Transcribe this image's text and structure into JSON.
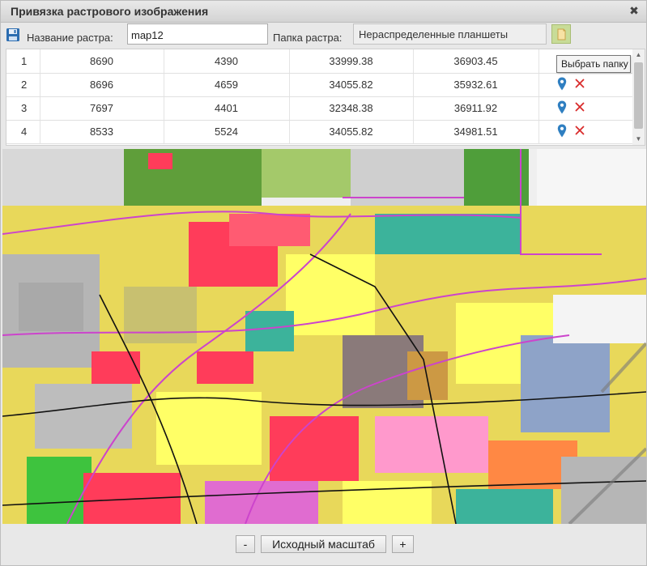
{
  "window": {
    "title": "Привязка растрового изображения",
    "close_glyph": "✖"
  },
  "toolbar": {
    "save_icon": "floppy-disk-icon",
    "raster_name_label": "Название растра:",
    "raster_name_value": "map12",
    "raster_folder_label": "Папка растра:",
    "raster_folder_value": "Нераспределенные планшеты",
    "select_folder_icon": "folder-icon",
    "select_folder_tooltip": "Выбрать папку"
  },
  "points": {
    "rows": [
      {
        "n": "1",
        "x": "8690",
        "y": "4390",
        "map_x": "33999.38",
        "map_y": "36903.45",
        "has_actions": false
      },
      {
        "n": "2",
        "x": "8696",
        "y": "4659",
        "map_x": "34055.82",
        "map_y": "35932.61",
        "has_actions": true
      },
      {
        "n": "3",
        "x": "7697",
        "y": "4401",
        "map_x": "32348.38",
        "map_y": "36911.92",
        "has_actions": true
      },
      {
        "n": "4",
        "x": "8533",
        "y": "5524",
        "map_x": "34055.82",
        "map_y": "34981.51",
        "has_actions": true
      }
    ],
    "locate_icon": "map-pin-icon",
    "delete_icon": "delete-x-icon"
  },
  "map": {
    "description_icon": "raster-map-image",
    "accent_colors": [
      "#ff3c5a",
      "#ffff66",
      "#3cb39b",
      "#b9b9b9",
      "#cc44cc"
    ]
  },
  "zoom": {
    "zoom_out_label": "-",
    "reset_label": "Исходный масштаб",
    "zoom_in_label": "+"
  },
  "colors": {
    "pin": "#2f7fc1",
    "delete": "#d92b2b",
    "folder_btn": "#c8dc98"
  }
}
